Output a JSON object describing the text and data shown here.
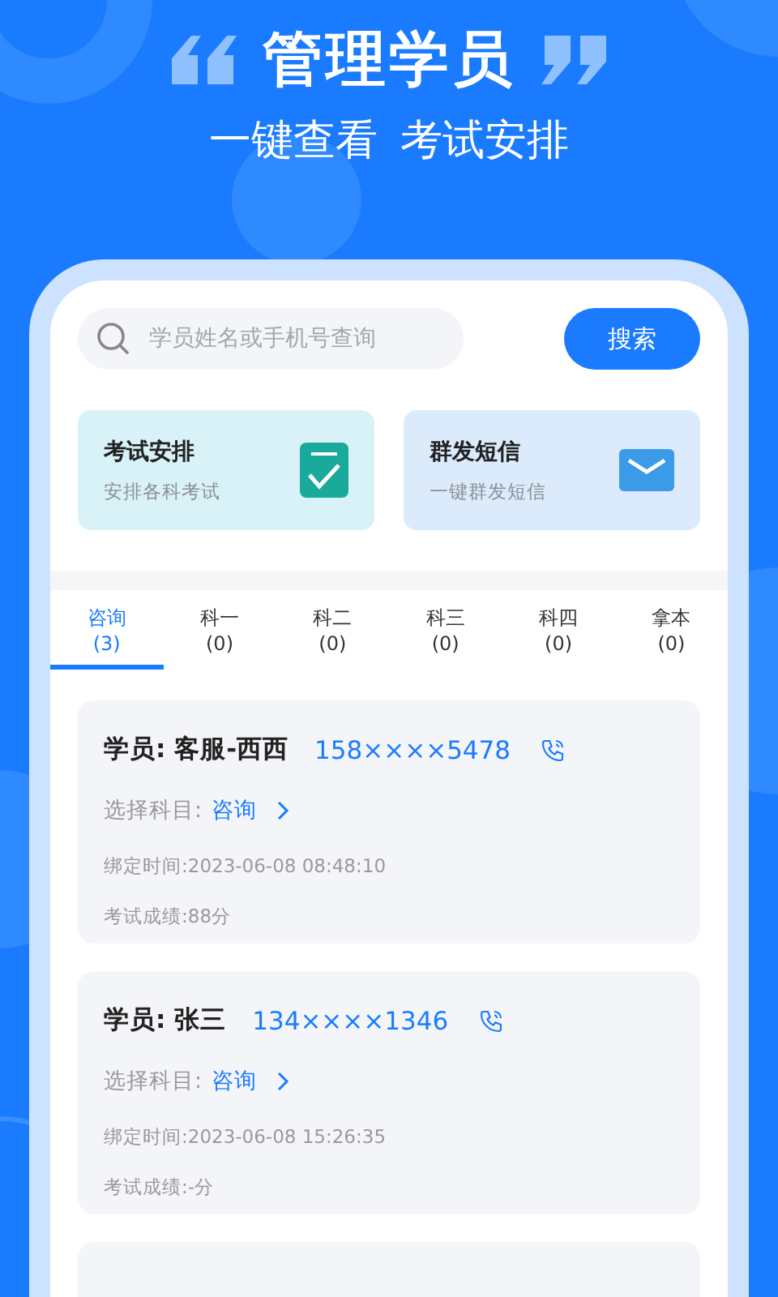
{
  "headline": "管理学员",
  "subtitle": "一键查看 考试安排",
  "search": {
    "placeholder": "学员姓名或手机号查询",
    "button": "搜索"
  },
  "shortcuts": [
    {
      "kind": "checklist",
      "title": "考试安排",
      "subtitle": "安排各科考试"
    },
    {
      "kind": "mail",
      "title": "群发短信",
      "subtitle": "一键群发短信"
    }
  ],
  "tabs": [
    {
      "label": "咨询",
      "count": "(3)",
      "selected": true
    },
    {
      "label": "科一",
      "count": "(0)",
      "selected": false
    },
    {
      "label": "科二",
      "count": "(0)",
      "selected": false
    },
    {
      "label": "科三",
      "count": "(0)",
      "selected": false
    },
    {
      "label": "科四",
      "count": "(0)",
      "selected": false
    },
    {
      "label": "拿本",
      "count": "(0)",
      "selected": false
    }
  ],
  "students": [
    {
      "name": "学员: 客服-西西",
      "phone": "158××××5478",
      "subject_label": "选择科目:",
      "subject": "咨询",
      "bound_time": "绑定时间:2023-06-08 08:48:10",
      "score": "考试成绩:88分"
    },
    {
      "name": "学员: 张三",
      "phone": "134××××1346",
      "subject_label": "选择科目:",
      "subject": "咨询",
      "bound_time": "绑定时间:2023-06-08 15:26:35",
      "score": "考试成绩:-分"
    }
  ]
}
